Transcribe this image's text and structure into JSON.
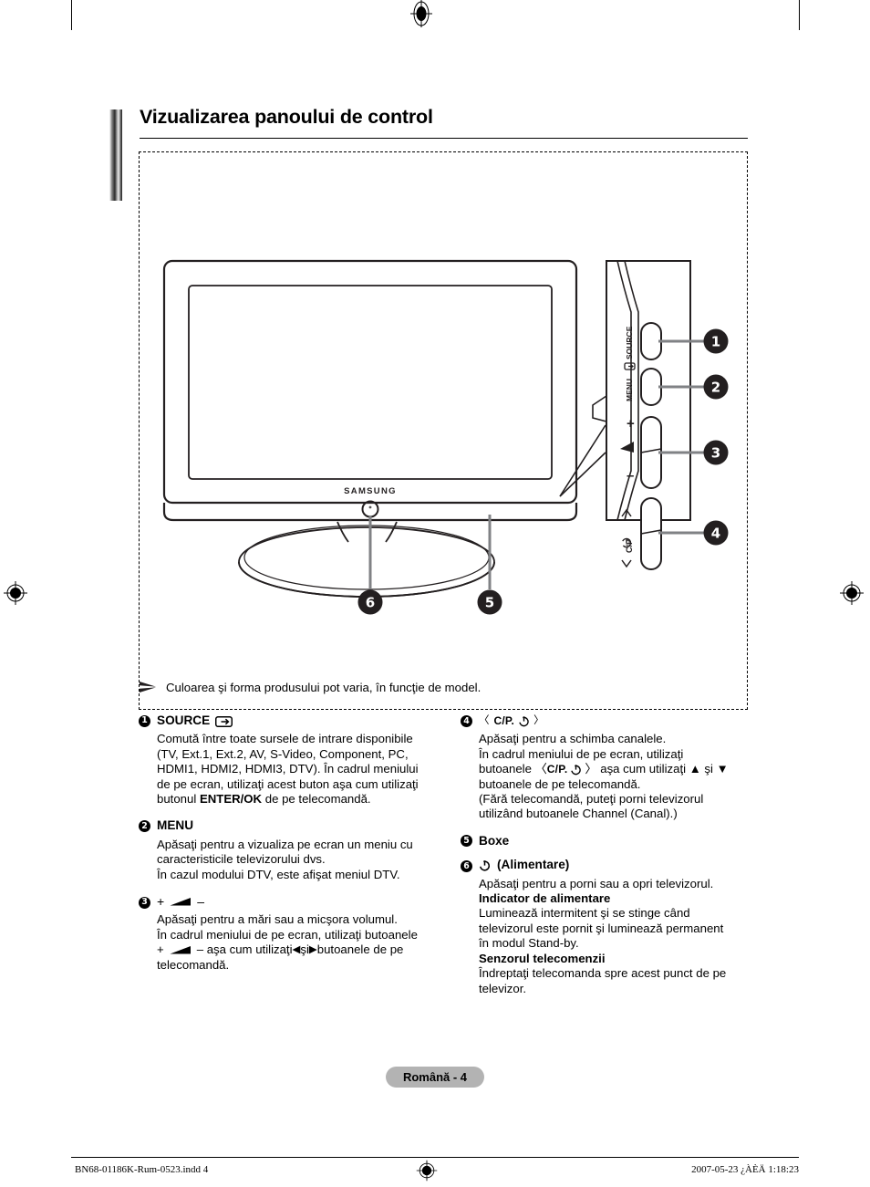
{
  "heading": {
    "title": "Vizualizarea panoului de control"
  },
  "figure": {
    "brand": "SAMSUNG",
    "panel_labels": {
      "source": "SOURCE",
      "menu": "MENU",
      "volume_plus": "+",
      "volume_minus": "–",
      "channel": "C/P"
    },
    "callouts": [
      "1",
      "2",
      "3",
      "4",
      "5",
      "6"
    ]
  },
  "note": {
    "marker_icon": "note-arrow-icon",
    "text": "Culoarea şi forma produsului pot varia, în funcţie de model."
  },
  "left_column": {
    "items": [
      {
        "number": "1",
        "label": "SOURCE",
        "icon": "source-input-icon",
        "lines": [
          "Comută între toate sursele de intrare disponibile",
          "(TV, Ext.1, Ext.2, AV, S-Video, Component, PC,",
          "HDMI1, HDMI2, HDMI3, DTV). În cadrul meniului",
          "de pe ecran, utilizaţi acest buton aşa cum utilizaţi"
        ],
        "last_line_pre": "butonul ",
        "last_line_bold": "ENTER/OK",
        "last_line_post": " de pe telecomandă."
      },
      {
        "number": "2",
        "label": "MENU",
        "lines": [
          "Apăsaţi pentru a vizualiza pe ecran un meniu cu",
          "caracteristicile televizorului dvs.",
          "În cazul modului DTV, este afişat meniul DTV."
        ]
      },
      {
        "number": "3",
        "label_plus": "+",
        "label_minus": "–",
        "icon": "volume-wedge-icon",
        "lines": [
          "Apăsaţi pentru a mări sau a micşora volumul.",
          "În cadrul meniului de pe ecran, utilizaţi butoanele"
        ],
        "line_mixed_a": "+",
        "line_mixed_b": "–  aşa cum utilizaţi ",
        "line_mixed_left_arrow": "◀",
        "line_mixed_c": " şi ",
        "line_mixed_right_arrow": "▶",
        "line_mixed_d": " butoanele de pe",
        "line_last": "telecomandă."
      }
    ]
  },
  "right_column": {
    "items": [
      {
        "number": "4",
        "label_open": "〈",
        "label_mid": "C/P.",
        "label_power": "power-icon",
        "label_close": "〉",
        "lines_a": [
          "Apăsaţi pentru a schimba canalele.",
          "În cadrul meniului de pe ecran, utilizaţi"
        ],
        "mixed_pre": "butoanele 〈 ",
        "mixed_bold": "C/P.",
        "mixed_power": "power-icon",
        "mixed_post": " 〉  aşa cum utilizaţi ▲ şi ▼",
        "lines_b": [
          "butoanele de pe telecomandă.",
          "(Fără telecomandă, puteţi porni televizorul",
          "utilizând butoanele Channel (Canal).)"
        ]
      },
      {
        "number": "5",
        "label": "Boxe"
      },
      {
        "number": "6",
        "icon": "power-icon",
        "label": "(Alimentare)",
        "lines": [
          "Apăsaţi pentru a porni sau a opri televizorul."
        ],
        "sub_sections": [
          {
            "title": "Indicator de alimentare",
            "lines": [
              "Luminează intermitent şi se stinge când",
              "televizorul este pornit şi luminează permanent",
              "în modul Stand-by."
            ]
          },
          {
            "title": "Senzorul telecomenzii",
            "lines": [
              "Îndreptaţi telecomanda spre acest punct de pe",
              "televizor."
            ]
          }
        ]
      }
    ]
  },
  "page_badge": {
    "label": "Română - 4"
  },
  "print_footer": {
    "left": "BN68-01186K-Rum-0523.indd   4",
    "right": "2007-05-23   ¿ÀÈÄ 1:18:23"
  }
}
